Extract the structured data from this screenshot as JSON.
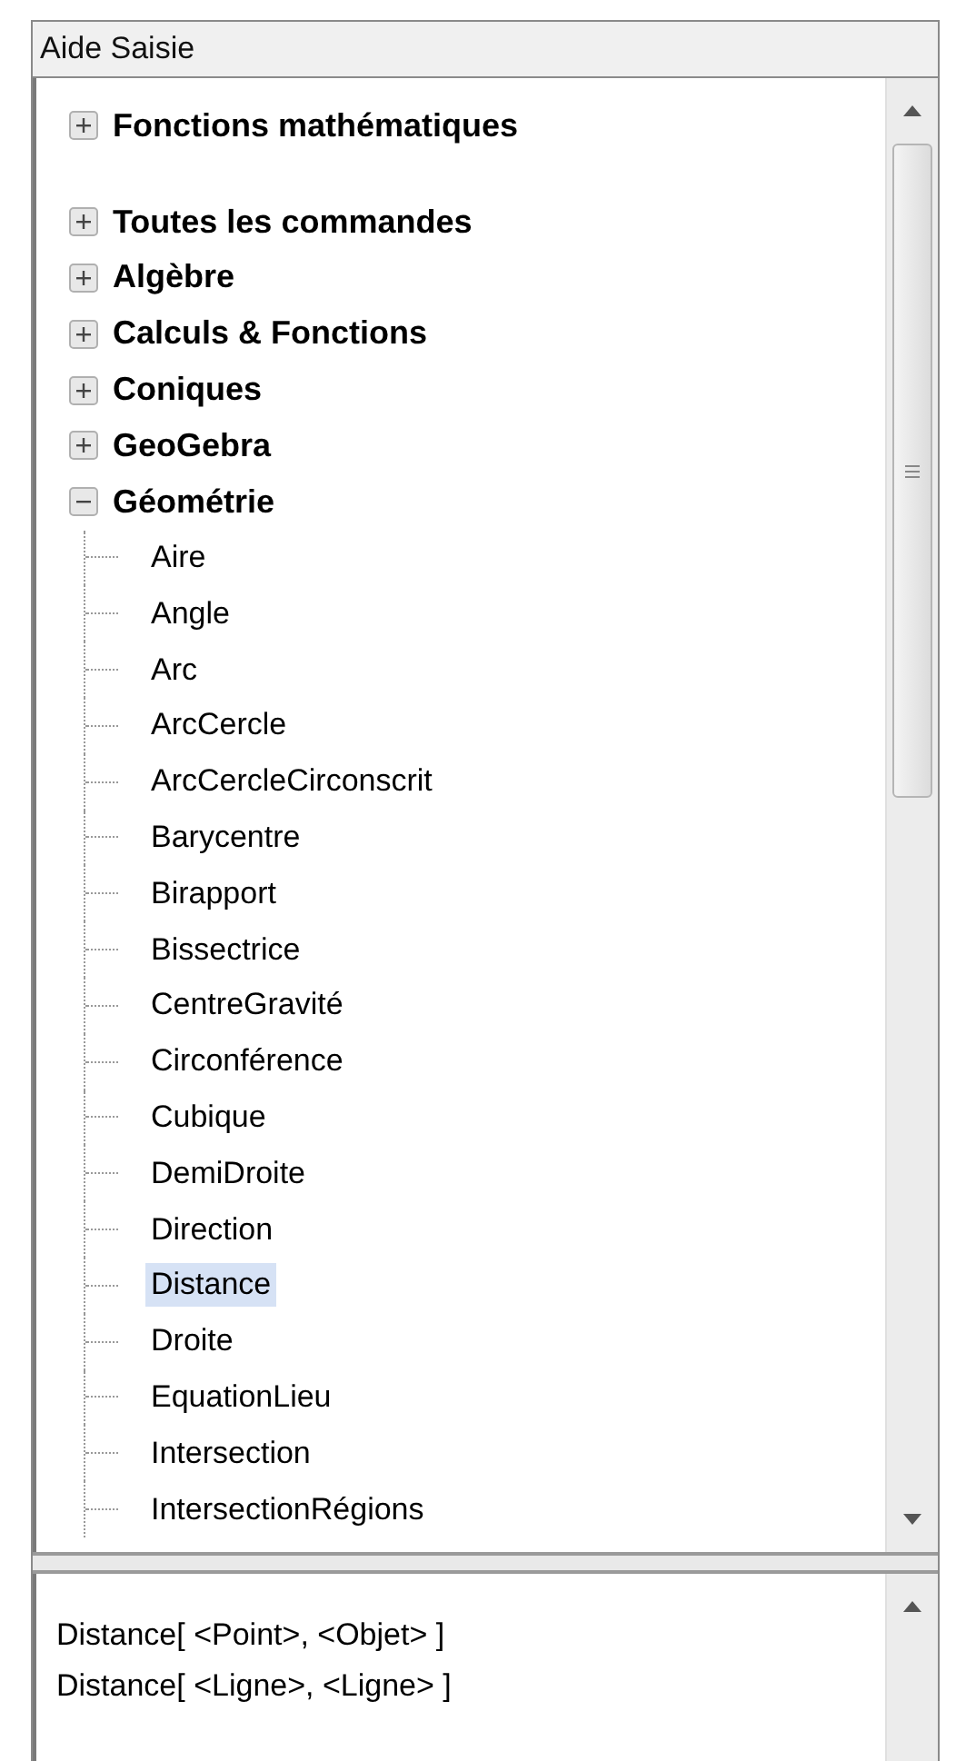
{
  "panel": {
    "title": "Aide Saisie"
  },
  "tree": {
    "sections": [
      {
        "items": [
          {
            "label": "Fonctions mathématiques",
            "expanded": false
          }
        ]
      },
      {
        "items": [
          {
            "label": "Toutes les commandes",
            "expanded": false
          },
          {
            "label": "Algèbre",
            "expanded": false
          },
          {
            "label": "Calculs & Fonctions",
            "expanded": false
          },
          {
            "label": "Coniques",
            "expanded": false
          },
          {
            "label": "GeoGebra",
            "expanded": false
          },
          {
            "label": "Géométrie",
            "expanded": true,
            "children": [
              {
                "label": "Aire",
                "selected": false
              },
              {
                "label": "Angle",
                "selected": false
              },
              {
                "label": "Arc",
                "selected": false
              },
              {
                "label": "ArcCercle",
                "selected": false
              },
              {
                "label": "ArcCercleCirconscrit",
                "selected": false
              },
              {
                "label": "Barycentre",
                "selected": false
              },
              {
                "label": "Birapport",
                "selected": false
              },
              {
                "label": "Bissectrice",
                "selected": false
              },
              {
                "label": "CentreGravité",
                "selected": false
              },
              {
                "label": "Circonférence",
                "selected": false
              },
              {
                "label": "Cubique",
                "selected": false
              },
              {
                "label": "DemiDroite",
                "selected": false
              },
              {
                "label": "Direction",
                "selected": false
              },
              {
                "label": "Distance",
                "selected": true
              },
              {
                "label": "Droite",
                "selected": false
              },
              {
                "label": "EquationLieu",
                "selected": false
              },
              {
                "label": "Intersection",
                "selected": false
              },
              {
                "label": "IntersectionRégions",
                "selected": false
              }
            ]
          }
        ]
      }
    ]
  },
  "syntax": {
    "lines": [
      "Distance[ <Point>, <Objet> ]",
      "Distance[ <Ligne>, <Ligne> ]"
    ]
  }
}
